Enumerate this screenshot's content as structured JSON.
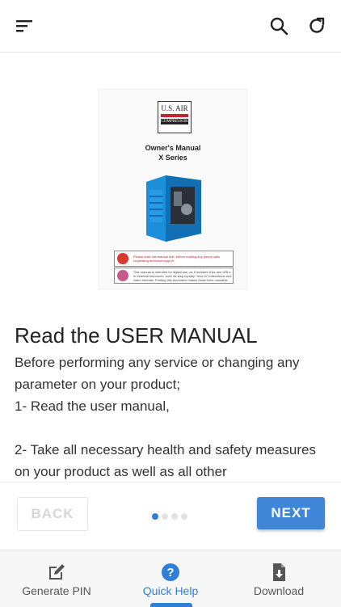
{
  "header": {
    "menu_icon": "sort-menu-icon",
    "search_icon": "search-icon",
    "refresh_icon": "refresh-icon"
  },
  "manual": {
    "logo_top": "U.S. AIR",
    "logo_bottom": "COMPRESSOR",
    "title_line1": "Owner's Manual",
    "title_line2": "X Series",
    "warning1": "Please read this manual first, before making any phone calls requesting technical support",
    "warning2": "This manual is intended for digital use, as it includes links and URLs to external resources, such as step-by-step \"how to\" instructions and video tutorials. Printing this document makes those links unusable."
  },
  "content": {
    "heading": "Read the USER MANUAL",
    "body": "Before performing any service or changing any parameter on your product;\n1- Read the user manual,\n\n2- Take all necessary health and safety measures on your product as well as all other"
  },
  "pager": {
    "back_label": "BACK",
    "next_label": "NEXT",
    "page_count": 4,
    "current_page": 1
  },
  "tabs": [
    {
      "label": "Generate PIN",
      "icon": "edit-icon"
    },
    {
      "label": "Quick Help",
      "icon": "help-icon"
    },
    {
      "label": "Download",
      "icon": "download-file-icon"
    }
  ],
  "colors": {
    "accent": "#2f7fd8",
    "next_button": "#3f86d8",
    "warning_red": "#c0262e"
  }
}
